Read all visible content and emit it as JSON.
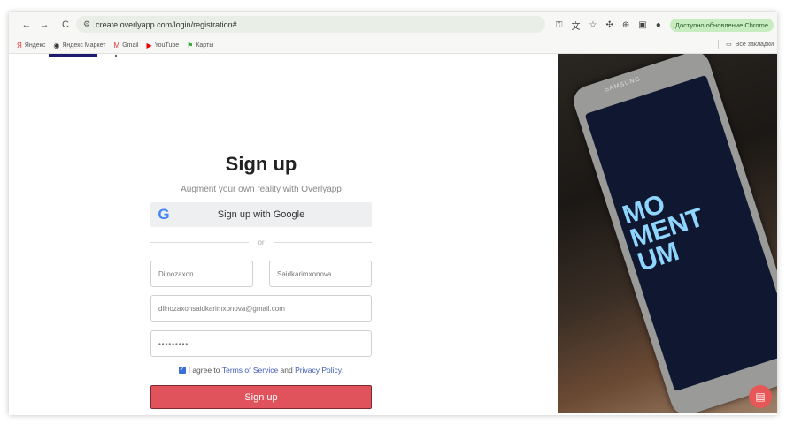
{
  "browser": {
    "nav": {
      "back_icon": "←",
      "forward_icon": "→",
      "reload_icon": "C"
    },
    "url": "create.overlyapp.com/login/registration#",
    "toolbar_icons": [
      "key-icon",
      "translate-icon",
      "star-icon",
      "extensions-icon",
      "download-icon",
      "sidebar-icon",
      "profile-icon"
    ],
    "update_label": "Доступно обновление Chrome",
    "bookmarks": [
      {
        "label": "Яндекс",
        "icon": "yandex-icon"
      },
      {
        "label": "Яндекс Маркет",
        "icon": "yandex-market-icon"
      },
      {
        "label": "Gmail",
        "icon": "gmail-icon"
      },
      {
        "label": "YouTube",
        "icon": "youtube-icon"
      },
      {
        "label": "Карты",
        "icon": "maps-icon"
      }
    ],
    "all_bookmarks": "Все закладки"
  },
  "form": {
    "title": "Sign up",
    "subtitle": "Augment your own reality with Overlyapp",
    "google_button": "Sign up with Google",
    "divider": "or",
    "first_name": "Dilnozaxon",
    "last_name": "Saidkarimxonova",
    "email": "dilnozaxonsaidkarimxonova@gmail.com",
    "password": "•••••••••",
    "agree_prefix": "I agree to ",
    "terms": "Terms of Service",
    "agree_and": " and ",
    "privacy": "Privacy Policy",
    "agree_suffix": ".",
    "submit": "Sign up"
  },
  "hero": {
    "brand": "SAMSUNG",
    "poster_words": [
      "MO",
      "MENT",
      "UM"
    ]
  },
  "colors": {
    "accent": "#e0535c",
    "link": "#3d5bb8",
    "google": "#4285f4",
    "update_bg": "#c7ecc0"
  }
}
